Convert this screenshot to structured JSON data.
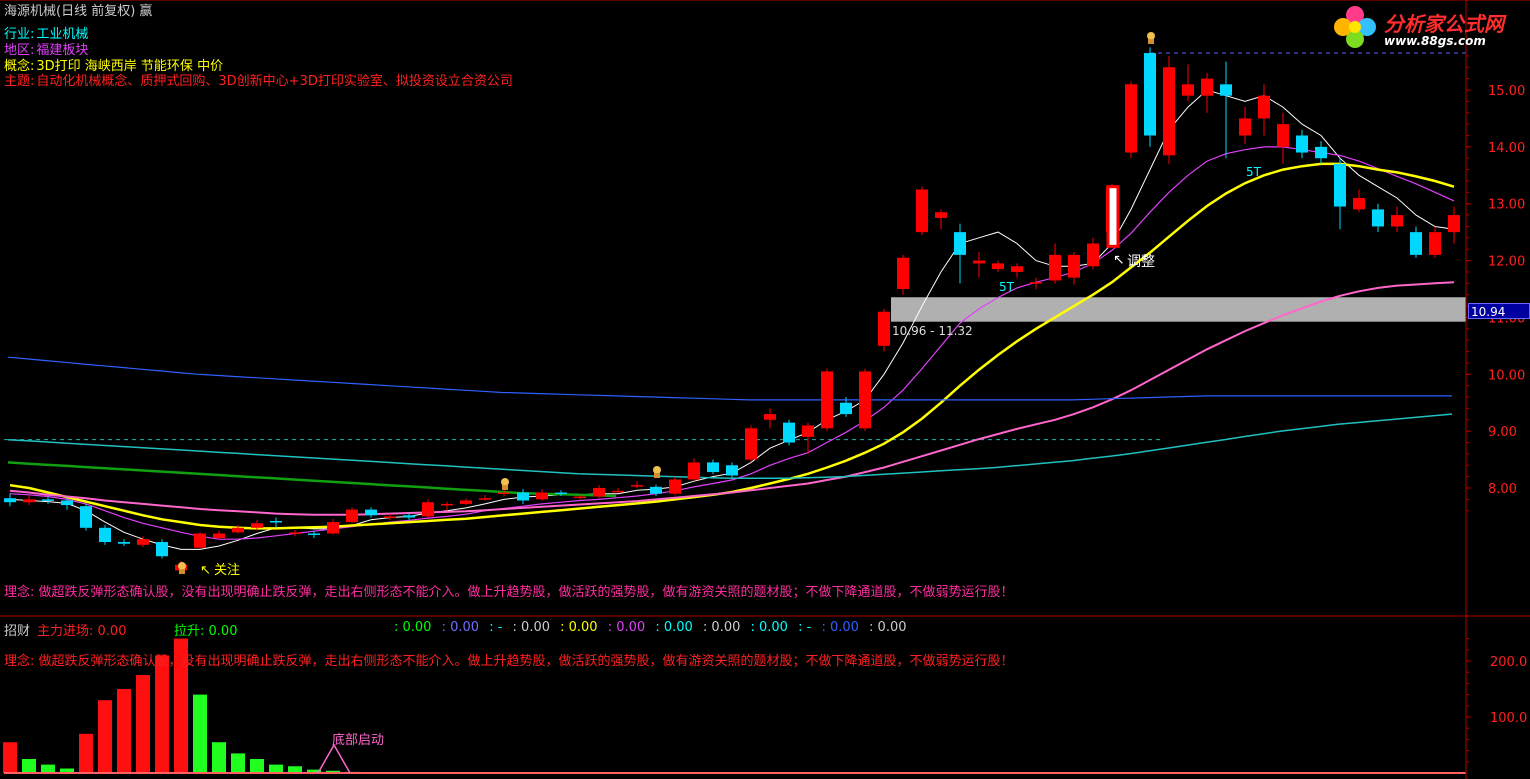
{
  "header": {
    "title": "海源机械(日线 前复权) 赢",
    "industry_label": "行业:",
    "industry": "工业机械",
    "region_label": "地区:",
    "region": "福建板块",
    "concept_label": "概念:",
    "concept": "3D打印 海峡西岸 节能环保 中价",
    "theme_label": "主题:",
    "theme": "自动化机械概念、质押式回购、3D创新中心+3D打印实验室、拟投资设立合资公司"
  },
  "logo": {
    "title": "分析家公式网",
    "url": "www.88gs.com",
    "icon": "flower-logo-icon"
  },
  "colors": {
    "up": "#ff0000",
    "down": "#00d8ff",
    "ma5": "#ffffff",
    "ma10": "#e040fb",
    "ma20": "#ffff00",
    "ma60": "#ff66cc",
    "ma120": "#20c0c0",
    "ma250": "#3060ff",
    "ma_green": "#10a010"
  },
  "annotations": {
    "watch": "关注",
    "adjust": "调整",
    "range": "10.96 - 11.32",
    "t_label_1": "5T",
    "t_label_2": "5T",
    "bottom_start": "底部启动"
  },
  "price_tag": "10.94",
  "philosophy": "理念: 做超跌反弹形态确认股，没有出现明确止跌反弹，走出右侧形态不能介入。做上升趋势股，做活跃的强势股，做有游资关照的题材股；不做下降通道股，不做弱势运行股！",
  "indicator": {
    "name": "招财",
    "main_label": "主力进场:",
    "main_value": "0.00",
    "lift_label": "拉升:",
    "lift_value": "0.00",
    "others": [
      {
        "text": ": 0.00",
        "color": "#00ff00"
      },
      {
        "text": ": 0.00",
        "color": "#7070ff"
      },
      {
        "text": ": -",
        "color": "#00ffff"
      },
      {
        "text": ": 0.00",
        "color": "#cccccc"
      },
      {
        "text": ": 0.00",
        "color": "#ffff00"
      },
      {
        "text": ": 0.00",
        "color": "#e040fb"
      },
      {
        "text": ": 0.00",
        "color": "#00ffff"
      },
      {
        "text": ": 0.00",
        "color": "#cccccc"
      },
      {
        "text": ": 0.00",
        "color": "#00ffff"
      },
      {
        "text": ": -",
        "color": "#00ffff"
      },
      {
        "text": ": 0.00",
        "color": "#3060ff"
      },
      {
        "text": ": 0.00",
        "color": "#cccccc"
      }
    ]
  },
  "chart_data": [
    {
      "type": "candlestick",
      "title": "海源机械(日线 前复权)",
      "y_ticks": [
        "15.00",
        "14.00",
        "13.00",
        "12.00",
        "11.00",
        "10.00",
        "9.00",
        "8.00"
      ],
      "ylim": [
        6.0,
        16.0
      ],
      "candles": [
        [
          7.82,
          7.75,
          7.9,
          7.68
        ],
        [
          7.75,
          7.8,
          7.88,
          7.7
        ],
        [
          7.8,
          7.78,
          7.85,
          7.72
        ],
        [
          7.78,
          7.7,
          7.82,
          7.62
        ],
        [
          7.68,
          7.3,
          7.72,
          7.25
        ],
        [
          7.3,
          7.05,
          7.35,
          7.0
        ],
        [
          7.05,
          7.02,
          7.1,
          6.98
        ],
        [
          7.0,
          7.1,
          7.15,
          6.96
        ],
        [
          7.05,
          6.8,
          7.1,
          6.76
        ],
        [
          6.55,
          6.65,
          6.72,
          6.5
        ],
        [
          6.95,
          7.2,
          7.22,
          6.93
        ],
        [
          7.12,
          7.2,
          7.25,
          7.1
        ],
        [
          7.22,
          7.3,
          7.35,
          7.2
        ],
        [
          7.3,
          7.38,
          7.44,
          7.25
        ],
        [
          7.42,
          7.4,
          7.48,
          7.3
        ],
        [
          7.2,
          7.22,
          7.26,
          7.15
        ],
        [
          7.2,
          7.18,
          7.25,
          7.12
        ],
        [
          7.2,
          7.4,
          7.45,
          7.18
        ],
        [
          7.4,
          7.62,
          7.66,
          7.38
        ],
        [
          7.62,
          7.52,
          7.66,
          7.48
        ],
        [
          7.5,
          7.5,
          7.55,
          7.44
        ],
        [
          7.52,
          7.48,
          7.56,
          7.44
        ],
        [
          7.5,
          7.75,
          7.8,
          7.48
        ],
        [
          7.72,
          7.72,
          7.76,
          7.6
        ],
        [
          7.72,
          7.78,
          7.82,
          7.7
        ],
        [
          7.82,
          7.82,
          7.88,
          7.78
        ],
        [
          7.9,
          7.92,
          8.0,
          7.85
        ],
        [
          7.92,
          7.78,
          7.98,
          7.72
        ],
        [
          7.8,
          7.92,
          7.98,
          7.78
        ],
        [
          7.92,
          7.9,
          7.96,
          7.86
        ],
        [
          7.85,
          7.85,
          7.88,
          7.8
        ],
        [
          7.85,
          8.0,
          8.05,
          7.82
        ],
        [
          7.95,
          7.95,
          8.0,
          7.92
        ],
        [
          8.05,
          8.05,
          8.12,
          8.0
        ],
        [
          8.02,
          7.9,
          8.06,
          7.86
        ],
        [
          7.9,
          8.15,
          8.2,
          7.88
        ],
        [
          8.15,
          8.45,
          8.52,
          8.12
        ],
        [
          8.45,
          8.28,
          8.5,
          8.24
        ],
        [
          8.4,
          8.22,
          8.45,
          8.18
        ],
        [
          8.5,
          9.05,
          9.1,
          8.45
        ],
        [
          9.2,
          9.3,
          9.4,
          9.05
        ],
        [
          9.15,
          8.8,
          9.2,
          8.75
        ],
        [
          8.9,
          9.1,
          9.15,
          8.6
        ],
        [
          9.05,
          10.05,
          10.1,
          9.0
        ],
        [
          9.5,
          9.3,
          9.6,
          9.25
        ],
        [
          9.05,
          10.05,
          10.1,
          9.0
        ],
        [
          10.5,
          11.1,
          11.15,
          10.4
        ],
        [
          11.5,
          12.05,
          12.1,
          11.4
        ],
        [
          12.5,
          13.25,
          13.3,
          12.45
        ],
        [
          12.75,
          12.85,
          12.9,
          12.55
        ],
        [
          12.5,
          12.1,
          12.65,
          11.6
        ],
        [
          11.95,
          12.0,
          12.15,
          11.7
        ],
        [
          11.85,
          11.95,
          12.0,
          11.8
        ],
        [
          11.8,
          11.9,
          11.95,
          11.7
        ],
        [
          11.6,
          11.62,
          11.7,
          11.5
        ],
        [
          11.65,
          12.1,
          12.3,
          11.6
        ],
        [
          11.7,
          12.1,
          12.15,
          11.58
        ],
        [
          11.9,
          12.3,
          12.4,
          11.85
        ],
        [
          12.5,
          13.3,
          13.35,
          12.4
        ],
        [
          13.9,
          15.1,
          15.15,
          13.8
        ],
        [
          15.65,
          14.2,
          15.75,
          14.0
        ],
        [
          13.85,
          15.4,
          15.6,
          13.7
        ],
        [
          14.9,
          15.1,
          15.45,
          14.8
        ],
        [
          14.9,
          15.2,
          15.3,
          14.6
        ],
        [
          15.1,
          14.9,
          15.5,
          13.8
        ],
        [
          14.2,
          14.5,
          14.7,
          14.05
        ],
        [
          14.5,
          14.9,
          15.1,
          14.2
        ],
        [
          14.0,
          14.4,
          14.6,
          13.7
        ],
        [
          14.2,
          13.9,
          14.3,
          13.8
        ],
        [
          14.0,
          13.8,
          14.1,
          13.7
        ],
        [
          13.7,
          12.95,
          13.8,
          12.55
        ],
        [
          12.9,
          13.1,
          13.25,
          12.85
        ],
        [
          12.9,
          12.6,
          13.0,
          12.5
        ],
        [
          12.6,
          12.8,
          12.95,
          12.5
        ],
        [
          12.5,
          12.1,
          12.6,
          12.05
        ],
        [
          12.1,
          12.5,
          12.6,
          12.05
        ],
        [
          12.5,
          12.8,
          12.95,
          12.3
        ]
      ],
      "series": [
        {
          "name": "MA5",
          "values": [
            7.8,
            7.78,
            7.76,
            7.73,
            7.6,
            7.4,
            7.22,
            7.1,
            7.0,
            6.92,
            6.92,
            6.98,
            7.08,
            7.2,
            7.3,
            7.3,
            7.28,
            7.28,
            7.34,
            7.44,
            7.48,
            7.5,
            7.56,
            7.6,
            7.65,
            7.72,
            7.8,
            7.84,
            7.86,
            7.88,
            7.88,
            7.9,
            7.9,
            7.96,
            7.98,
            8.02,
            8.12,
            8.2,
            8.26,
            8.45,
            8.7,
            8.84,
            8.98,
            9.2,
            9.35,
            9.55,
            10.0,
            10.55,
            11.2,
            11.8,
            12.3,
            12.4,
            12.5,
            12.3,
            12.0,
            11.9,
            11.9,
            11.95,
            12.3,
            12.9,
            13.6,
            14.3,
            14.7,
            15.0,
            14.9,
            14.8,
            14.9,
            14.7,
            14.4,
            14.2,
            13.8,
            13.5,
            13.3,
            13.1,
            12.8,
            12.6,
            12.55
          ]
        },
        {
          "name": "MA10",
          "values": [
            7.9,
            7.88,
            7.85,
            7.8,
            7.72,
            7.6,
            7.48,
            7.38,
            7.3,
            7.22,
            7.15,
            7.1,
            7.1,
            7.12,
            7.16,
            7.2,
            7.24,
            7.28,
            7.32,
            7.36,
            7.4,
            7.43,
            7.47,
            7.5,
            7.54,
            7.6,
            7.64,
            7.68,
            7.72,
            7.75,
            7.78,
            7.8,
            7.83,
            7.86,
            7.9,
            7.95,
            8.02,
            8.08,
            8.14,
            8.25,
            8.4,
            8.52,
            8.62,
            8.8,
            8.98,
            9.18,
            9.42,
            9.72,
            10.1,
            10.5,
            10.9,
            11.15,
            11.35,
            11.52,
            11.62,
            11.7,
            11.8,
            11.95,
            12.18,
            12.48,
            12.85,
            13.2,
            13.5,
            13.75,
            13.88,
            13.95,
            14.0,
            14.0,
            13.95,
            13.9,
            13.85,
            13.75,
            13.62,
            13.48,
            13.35,
            13.2,
            13.05
          ]
        },
        {
          "name": "MA20",
          "values": [
            8.05,
            8.0,
            7.92,
            7.84,
            7.76,
            7.68,
            7.6,
            7.52,
            7.45,
            7.4,
            7.35,
            7.32,
            7.3,
            7.29,
            7.29,
            7.3,
            7.31,
            7.32,
            7.34,
            7.36,
            7.38,
            7.4,
            7.42,
            7.44,
            7.46,
            7.49,
            7.52,
            7.55,
            7.58,
            7.61,
            7.64,
            7.67,
            7.7,
            7.73,
            7.76,
            7.8,
            7.84,
            7.88,
            7.93,
            8.0,
            8.08,
            8.16,
            8.25,
            8.36,
            8.48,
            8.62,
            8.78,
            8.98,
            9.22,
            9.5,
            9.8,
            10.08,
            10.34,
            10.58,
            10.8,
            11.0,
            11.2,
            11.4,
            11.62,
            11.88,
            12.14,
            12.42,
            12.7,
            12.96,
            13.18,
            13.36,
            13.5,
            13.6,
            13.66,
            13.7,
            13.7,
            13.66,
            13.6,
            13.55,
            13.48,
            13.4,
            13.3
          ]
        },
        {
          "name": "MA60",
          "values": [
            7.95,
            7.92,
            7.88,
            7.85,
            7.82,
            7.78,
            7.75,
            7.72,
            7.69,
            7.66,
            7.63,
            7.61,
            7.59,
            7.57,
            7.55,
            7.54,
            7.53,
            7.53,
            7.53,
            7.54,
            7.55,
            7.56,
            7.57,
            7.58,
            7.59,
            7.61,
            7.63,
            7.65,
            7.67,
            7.69,
            7.71,
            7.73,
            7.75,
            7.77,
            7.8,
            7.83,
            7.86,
            7.89,
            7.92,
            7.96,
            8.0,
            8.04,
            8.08,
            8.14,
            8.2,
            8.28,
            8.36,
            8.46,
            8.56,
            8.66,
            8.76,
            8.86,
            8.95,
            9.04,
            9.12,
            9.2,
            9.3,
            9.42,
            9.56,
            9.72,
            9.9,
            10.08,
            10.26,
            10.44,
            10.6,
            10.76,
            10.9,
            11.04,
            11.16,
            11.28,
            11.38,
            11.46,
            11.52,
            11.56,
            11.58,
            11.6,
            11.62
          ]
        },
        {
          "name": "MA120",
          "values": [
            8.85,
            8.83,
            8.81,
            8.79,
            8.77,
            8.75,
            8.73,
            8.71,
            8.69,
            8.67,
            8.65,
            8.63,
            8.61,
            8.59,
            8.57,
            8.55,
            8.53,
            8.51,
            8.49,
            8.47,
            8.45,
            8.43,
            8.41,
            8.39,
            8.37,
            8.35,
            8.33,
            8.31,
            8.29,
            8.27,
            8.25,
            8.24,
            8.23,
            8.22,
            8.21,
            8.2,
            8.19,
            8.18,
            8.17,
            8.17,
            8.17,
            8.17,
            8.18,
            8.19,
            8.2,
            8.22,
            8.24,
            8.26,
            8.28,
            8.3,
            8.32,
            8.34,
            8.36,
            8.39,
            8.42,
            8.45,
            8.48,
            8.52,
            8.56,
            8.6,
            8.65,
            8.7,
            8.75,
            8.8,
            8.85,
            8.9,
            8.95,
            9.0,
            9.04,
            9.08,
            9.12,
            9.15,
            9.18,
            9.21,
            9.24,
            9.27,
            9.3
          ]
        },
        {
          "name": "MA250",
          "values": [
            10.3,
            10.27,
            10.24,
            10.21,
            10.18,
            10.15,
            10.12,
            10.09,
            10.06,
            10.03,
            10.0,
            9.98,
            9.96,
            9.94,
            9.92,
            9.9,
            9.88,
            9.86,
            9.84,
            9.82,
            9.8,
            9.78,
            9.76,
            9.74,
            9.72,
            9.7,
            9.68,
            9.67,
            9.66,
            9.65,
            9.64,
            9.63,
            9.62,
            9.61,
            9.6,
            9.59,
            9.58,
            9.57,
            9.56,
            9.55,
            9.55,
            9.55,
            9.55,
            9.55,
            9.55,
            9.55,
            9.55,
            9.55,
            9.55,
            9.55,
            9.55,
            9.55,
            9.55,
            9.55,
            9.55,
            9.55,
            9.55,
            9.56,
            9.57,
            9.58,
            9.59,
            9.6,
            9.61,
            9.62,
            9.62,
            9.62,
            9.62,
            9.62,
            9.62,
            9.62,
            9.62,
            9.62,
            9.62,
            9.62,
            9.62,
            9.62,
            9.62
          ]
        },
        {
          "name": "MA-green",
          "values": [
            8.45,
            8.43,
            8.41,
            8.39,
            8.37,
            8.35,
            8.33,
            8.31,
            8.29,
            8.27,
            8.25,
            8.23,
            8.21,
            8.19,
            8.17,
            8.15,
            8.13,
            8.11,
            8.09,
            8.07,
            8.05,
            8.03,
            8.01,
            7.99,
            7.97,
            7.95,
            7.93,
            7.91,
            7.9,
            7.89,
            7.88,
            7.87,
            7.86
          ]
        }
      ],
      "gray_band": [
        10.96,
        11.32
      ],
      "dashed_levels": [
        15.65,
        8.85
      ]
    },
    {
      "type": "bar",
      "title": "招财",
      "y_ticks": [
        "200.0",
        "100.0"
      ],
      "ylim": [
        0,
        270
      ],
      "values": [
        55,
        25,
        15,
        8,
        70,
        130,
        150,
        175,
        210,
        240,
        140,
        55,
        35,
        25,
        15,
        12,
        6,
        4,
        2,
        0,
        0,
        0,
        0,
        0
      ],
      "colors": [
        "up",
        "down",
        "down",
        "down",
        "up",
        "up",
        "up",
        "up",
        "up",
        "up",
        "down",
        "down",
        "down",
        "down",
        "down",
        "down",
        "down",
        "down",
        "down",
        "up",
        "up",
        "up",
        "up",
        "up"
      ]
    }
  ]
}
